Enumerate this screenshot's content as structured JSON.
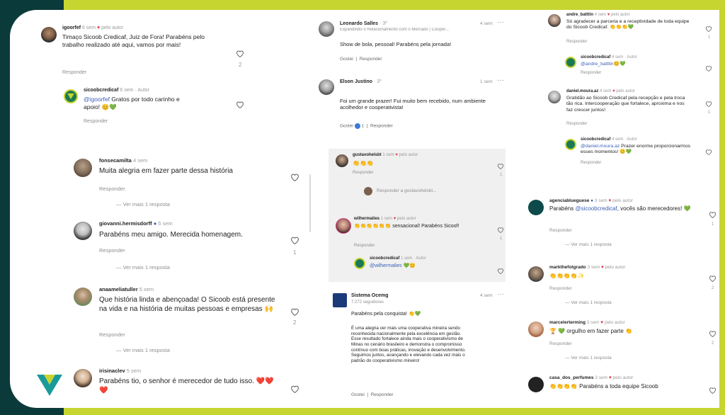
{
  "col1": {
    "c1": {
      "user": "igoorfef",
      "meta": "6 sem",
      "liked": "pelo autor",
      "text": "Timaço Sicoob Credicaf, Juiz de Fora! Parabéns pelo trabalho realizado até aqui, vamos por mais!",
      "reply": "Responder",
      "likes": "2"
    },
    "c2": {
      "user": "sicoobcredicaf",
      "meta": "6 sem · Autor",
      "tag": "@igoorfef",
      "text": " Gratos por todo carinho e apoio! 😊💚",
      "reply": "Responder"
    }
  },
  "col2": {
    "c1": {
      "user": "fonsecamilta",
      "meta": "4 sem",
      "text": "Muita alegria  em fazer parte dessa história",
      "reply": "Responder",
      "more": "Ver mais 1 resposta"
    },
    "c2": {
      "user": "giovanni.hermisdorff",
      "meta": "5 sem",
      "text": "Parabéns meu amigo. Merecida homenagem.",
      "reply": "Responder",
      "likes": "1",
      "more": "Ver mais 1 resposta"
    },
    "c3": {
      "user": "anaameliatuller",
      "meta": "5 sem",
      "text": "Que história linda e abençoada! O Sicoob está presente na vida e na história de muitas pessoas e empresas 🙌",
      "reply": "Responder",
      "likes": "2",
      "more": "Ver mais 1 resposta"
    },
    "c4": {
      "user": "irisinaclev",
      "meta": "5 sem",
      "text": "Parabéns tio, o senhor é merecedor de tudo isso. ❤️❤️❤️"
    }
  },
  "col3": {
    "c1": {
      "user": "Leonardo Salles",
      "meta": "· 3º",
      "sub": "Expandindo o Relacionamento com o Mercado | Cooper...",
      "time": "4 sem",
      "text": "Show de bola, pessoal! Parabéns pela jornada!",
      "a1": "Gostei",
      "a2": "Responder"
    },
    "c2": {
      "user": "Elson Justino",
      "meta": "· 3º",
      "time": "1 sem",
      "text": "Foi um grande prazer! Fui muito bem recebido, num ambiente acolhedor e cooperativista!",
      "a1": "Gostei",
      "count": "1",
      "a2": "Responder"
    },
    "c3": {
      "user": "gustavohelsbt",
      "meta": "1 sem",
      "liked": "pelo autor",
      "text": "👏👏👏",
      "reply": "Responder",
      "likes": "1",
      "replyto": "Responder a gustavohelsbt..."
    },
    "c4": {
      "user": "wilhermalies",
      "meta": "1 sem",
      "liked": "pelo autor",
      "text": "👏👏👏👏👏👏 sensacional! Parabéns Sicoof!",
      "reply": "Responder",
      "likes": "1"
    },
    "c5": {
      "user": "sicoobcredicaf",
      "meta": "1 sem · Autor",
      "tag": "@wilhermalies",
      "text": " 💚😊"
    },
    "c6": {
      "user": "Sistema Ocemg",
      "sub": "7.272 seguidores",
      "time": "4 sem",
      "text1": "Parabéns pela conquista! 👏💚",
      "text2": "É uma alegria ver mais uma cooperativa mineira sendo reconhecida nacionalmente pela excelência em gestão. Esse resultado fortalece ainda mais o cooperativismo de Minas no cenário brasileiro e demonstra o compromisso contínuo com boas práticas, inovação e desenvolvimento. Seguimos juntos, avançando e elevando cada vez mais o padrão do cooperativismo mineiro!",
      "a1": "Gostei",
      "a2": "Responder"
    }
  },
  "col4": {
    "c1": {
      "user": "andre_batttin",
      "meta": "4 sem",
      "liked": "pelo autor",
      "text": "Só agradecer a parceria e a receptividade de toda equipe do Sicoob Credicaf. 👏👏👏💚",
      "reply": "Responder",
      "likes": "1"
    },
    "c2": {
      "user": "sicoobcredicaf",
      "meta": "4 sem · Autor",
      "tag": "@andre_batttin",
      "text": "😊💚",
      "reply": "Responder"
    },
    "c3": {
      "user": "daniel.moura.az",
      "meta": "4 sem",
      "liked": "pelo autor",
      "text": "Gratidão ao Sicoob Credicaf pela recepção e pela troca tão rica. Intercooperação que fortalece, aproxima e nos faz crescer juntos!",
      "reply": "Responder",
      "likes": "1"
    },
    "c4": {
      "user": "sicoobcredicaf",
      "meta": "4 sem · Autor",
      "tag": "@daniel.moura.az",
      "text": " Prazer enorme proporcionarmos esses momentos! 😊💚",
      "reply": "Responder"
    },
    "c5": {
      "user": "agenciablueguese",
      "meta": "3 sem",
      "liked": "pelo autor",
      "tag": "@sicoobcredicaf",
      "text1": "Parabéns ",
      "text2": ", vocês são merecedores! 💚",
      "reply": "Responder",
      "likes": "1",
      "more": "Ver mais 1 resposta"
    },
    "c6": {
      "user": "markthefotgrado",
      "meta": "3 sem",
      "liked": "pelo autor",
      "text": "👏👏👏👏✨",
      "reply": "Responder",
      "likes": "2",
      "more": "Ver mais 1 resposta"
    },
    "c7": {
      "user": "marcelerterming",
      "meta": "3 sem",
      "liked": "pelo autor",
      "text": "🏆 💚 orgulho em fazer parte 👏",
      "reply": "Responder",
      "likes": "2",
      "more": "Ver mais 1 resposta"
    },
    "c8": {
      "user": "casa_dos_perfumes",
      "meta": "3 sem",
      "liked": "pelo autor",
      "text": "👏👏👏👏 Parabéns a toda equipe Sicoob"
    }
  },
  "colors": {
    "lime": "#c7d530",
    "teal": "#0b3a3a",
    "heart": "#e23a4d",
    "link": "#3a5fb8",
    "sicoob_green": "#1b7a55"
  }
}
